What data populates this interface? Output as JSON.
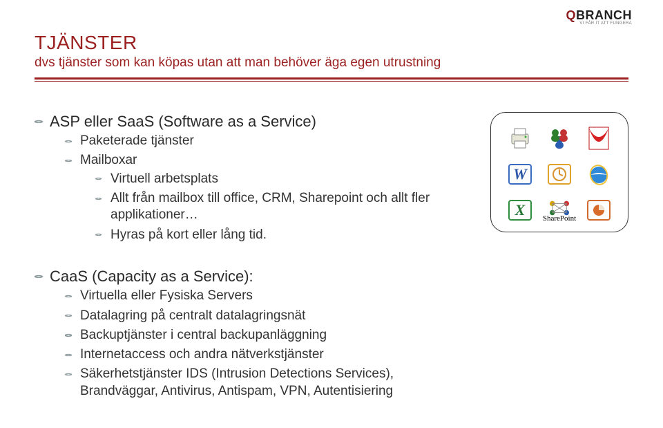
{
  "brand": {
    "name_q": "Q",
    "name_branch": "BRANCH",
    "tagline": "VI FÅR IT ATT FUNGERA"
  },
  "title": "TJÄNSTER",
  "subtitle": "dvs tjänster som kan köpas utan att man behöver äga egen utrustning",
  "section1": {
    "heading": "ASP eller SaaS (Software as a Service)",
    "items": [
      "Paketerade tjänster",
      "Mailboxar",
      "Virtuell arbetsplats",
      "Allt från mailbox till office, CRM, Sharepoint och allt fler applikationer…",
      "Hyras på kort eller lång tid."
    ]
  },
  "section2": {
    "heading": "CaaS (Capacity as a Service):",
    "items": [
      "Virtuella eller Fysiska Servers",
      "Datalagring på centralt datalagringsnät",
      "Backuptjänster i central backupanläggning",
      "Internetaccess och andra nätverkstjänster",
      "Säkerhetstjänster IDS (Intrusion Detections Services), Brandväggar, Antivirus, Antispam, VPN, Autentisiering"
    ]
  },
  "iconcard": {
    "icons": [
      [
        "printer-icon",
        "users-icon",
        "acrobat-icon"
      ],
      [
        "word-icon",
        "outlook-icon",
        "ie-icon"
      ],
      [
        "excel-icon",
        "sharepoint-icon",
        "powerpoint-icon"
      ]
    ],
    "sharepoint_label": "SharePoint"
  }
}
